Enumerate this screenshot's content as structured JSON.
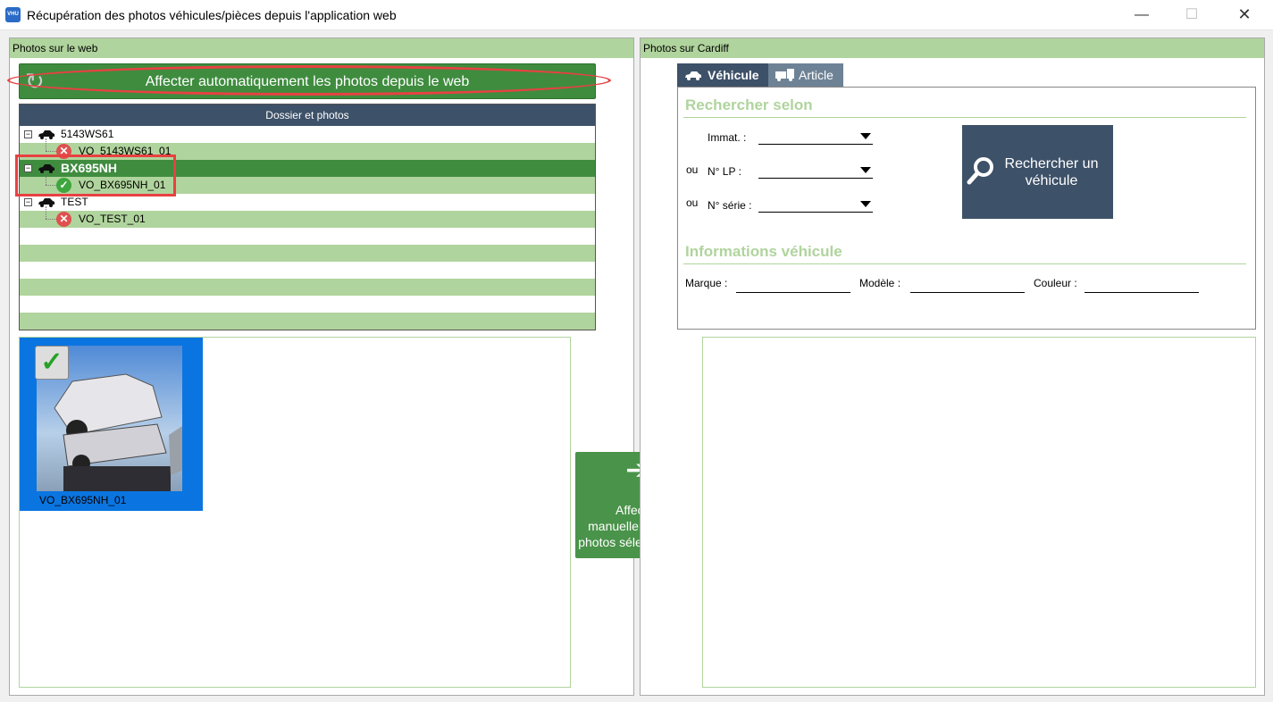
{
  "window": {
    "title": "Récupération des photos véhicules/pièces depuis l'application web",
    "app_icon_text": "VHU",
    "minimize": "—",
    "maximize": "☐",
    "close": "✕"
  },
  "left": {
    "header": "Photos sur le web",
    "auto_button": "Affecter automatiquement les photos depuis le web",
    "tree": {
      "header": "Dossier et photos",
      "nodes": [
        {
          "label": "5143WS61",
          "photo": "VO_5143WS61_01",
          "status": "error"
        },
        {
          "label": "BX695NH",
          "photo": "VO_BX695NH_01",
          "status": "ok",
          "selected": true
        },
        {
          "label": "TEST",
          "photo": "VO_TEST_01",
          "status": "error"
        }
      ]
    },
    "thumbnail": {
      "label": "VO_BX695NH_01",
      "checked": true
    }
  },
  "manual_button": {
    "label": "Affecter manuellement les photos sélectionnées"
  },
  "right": {
    "header": "Photos sur Cardiff",
    "tabs": [
      {
        "label": "Véhicule",
        "active": true
      },
      {
        "label": "Article",
        "active": false
      }
    ],
    "search": {
      "title": "Rechercher selon",
      "fields": [
        {
          "prefix": "",
          "label": "Immat. :",
          "value": ""
        },
        {
          "prefix": "ou",
          "label": "N° LP :",
          "value": ""
        },
        {
          "prefix": "ou",
          "label": "N° série :",
          "value": ""
        }
      ],
      "button": "Rechercher un véhicule"
    },
    "info": {
      "title": "Informations véhicule",
      "fields": [
        {
          "label": "Marque :",
          "value": ""
        },
        {
          "label": "Modèle :",
          "value": ""
        },
        {
          "label": "Couleur :",
          "value": ""
        }
      ]
    }
  },
  "colors": {
    "accent_green": "#3f8c3f",
    "light_green": "#b0d49d",
    "dark_slate": "#3d5168",
    "highlight_red": "#e84141",
    "selection_blue": "#0a75e0"
  }
}
